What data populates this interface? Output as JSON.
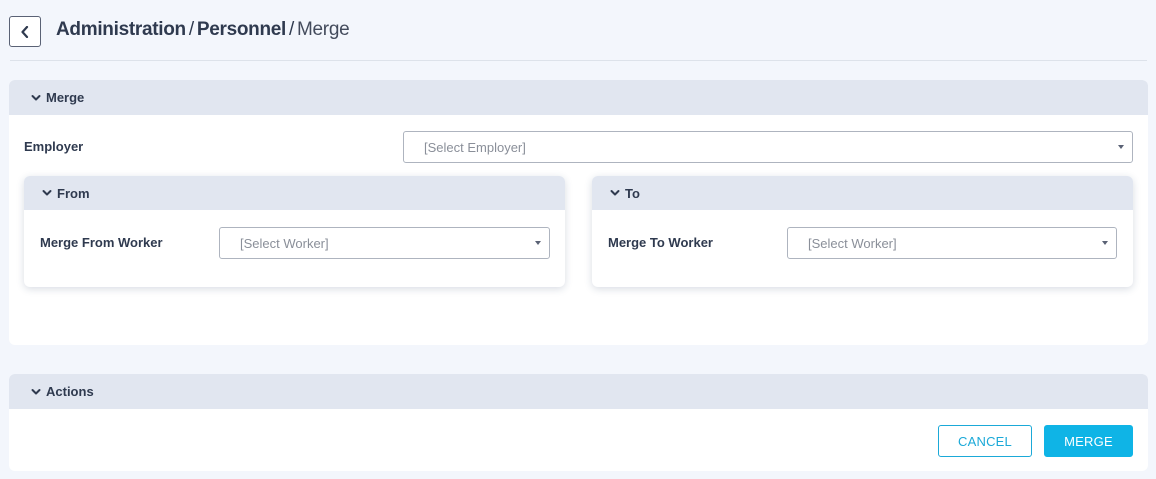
{
  "header": {
    "breadcrumb": [
      "Administration",
      "Personnel",
      "Merge"
    ],
    "separator": "/",
    "back_icon": "chevron-left-icon"
  },
  "merge_section": {
    "title": "Merge",
    "employer": {
      "label": "Employer",
      "placeholder": "[Select Employer]"
    },
    "from": {
      "title": "From",
      "label": "Merge From Worker",
      "placeholder": "[Select Worker]"
    },
    "to": {
      "title": "To",
      "label": "Merge To Worker",
      "placeholder": "[Select Worker]"
    }
  },
  "actions_section": {
    "title": "Actions",
    "cancel_label": "CANCEL",
    "merge_label": "MERGE"
  },
  "colors": {
    "accent": "#0fb4e6",
    "section_header": "#e1e6f0",
    "page_background": "#f3f6fc"
  }
}
